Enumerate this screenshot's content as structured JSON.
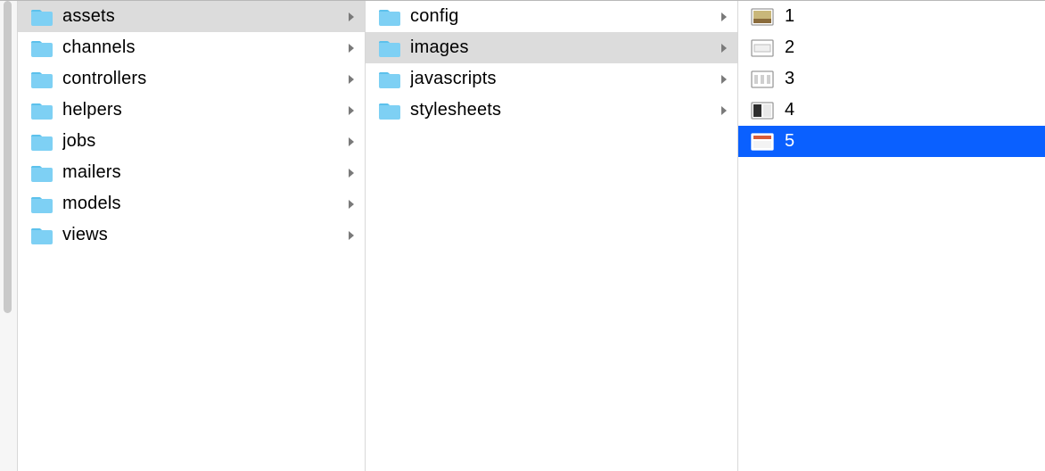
{
  "columns": [
    {
      "selected_index": 0,
      "items": [
        {
          "type": "folder",
          "label": "assets",
          "expandable": true
        },
        {
          "type": "folder",
          "label": "channels",
          "expandable": true
        },
        {
          "type": "folder",
          "label": "controllers",
          "expandable": true
        },
        {
          "type": "folder",
          "label": "helpers",
          "expandable": true
        },
        {
          "type": "folder",
          "label": "jobs",
          "expandable": true
        },
        {
          "type": "folder",
          "label": "mailers",
          "expandable": true
        },
        {
          "type": "folder",
          "label": "models",
          "expandable": true
        },
        {
          "type": "folder",
          "label": "views",
          "expandable": true
        }
      ]
    },
    {
      "selected_index": 1,
      "items": [
        {
          "type": "folder",
          "label": "config",
          "expandable": true
        },
        {
          "type": "folder",
          "label": "images",
          "expandable": true
        },
        {
          "type": "folder",
          "label": "javascripts",
          "expandable": true
        },
        {
          "type": "folder",
          "label": "stylesheets",
          "expandable": true
        }
      ]
    },
    {
      "selected_index": 4,
      "items": [
        {
          "type": "image",
          "label": "1",
          "expandable": false,
          "variant": 1
        },
        {
          "type": "image",
          "label": "2",
          "expandable": false,
          "variant": 2
        },
        {
          "type": "image",
          "label": "3",
          "expandable": false,
          "variant": 3
        },
        {
          "type": "image",
          "label": "4",
          "expandable": false,
          "variant": 4
        },
        {
          "type": "image",
          "label": "5",
          "expandable": false,
          "variant": 5
        }
      ]
    }
  ],
  "colors": {
    "selection_grey": "#dcdcdc",
    "selection_blue": "#0a60ff",
    "folder_fill": "#7ed0f4",
    "folder_tab": "#5cc1ec",
    "chevron": "#7a7a7a"
  }
}
